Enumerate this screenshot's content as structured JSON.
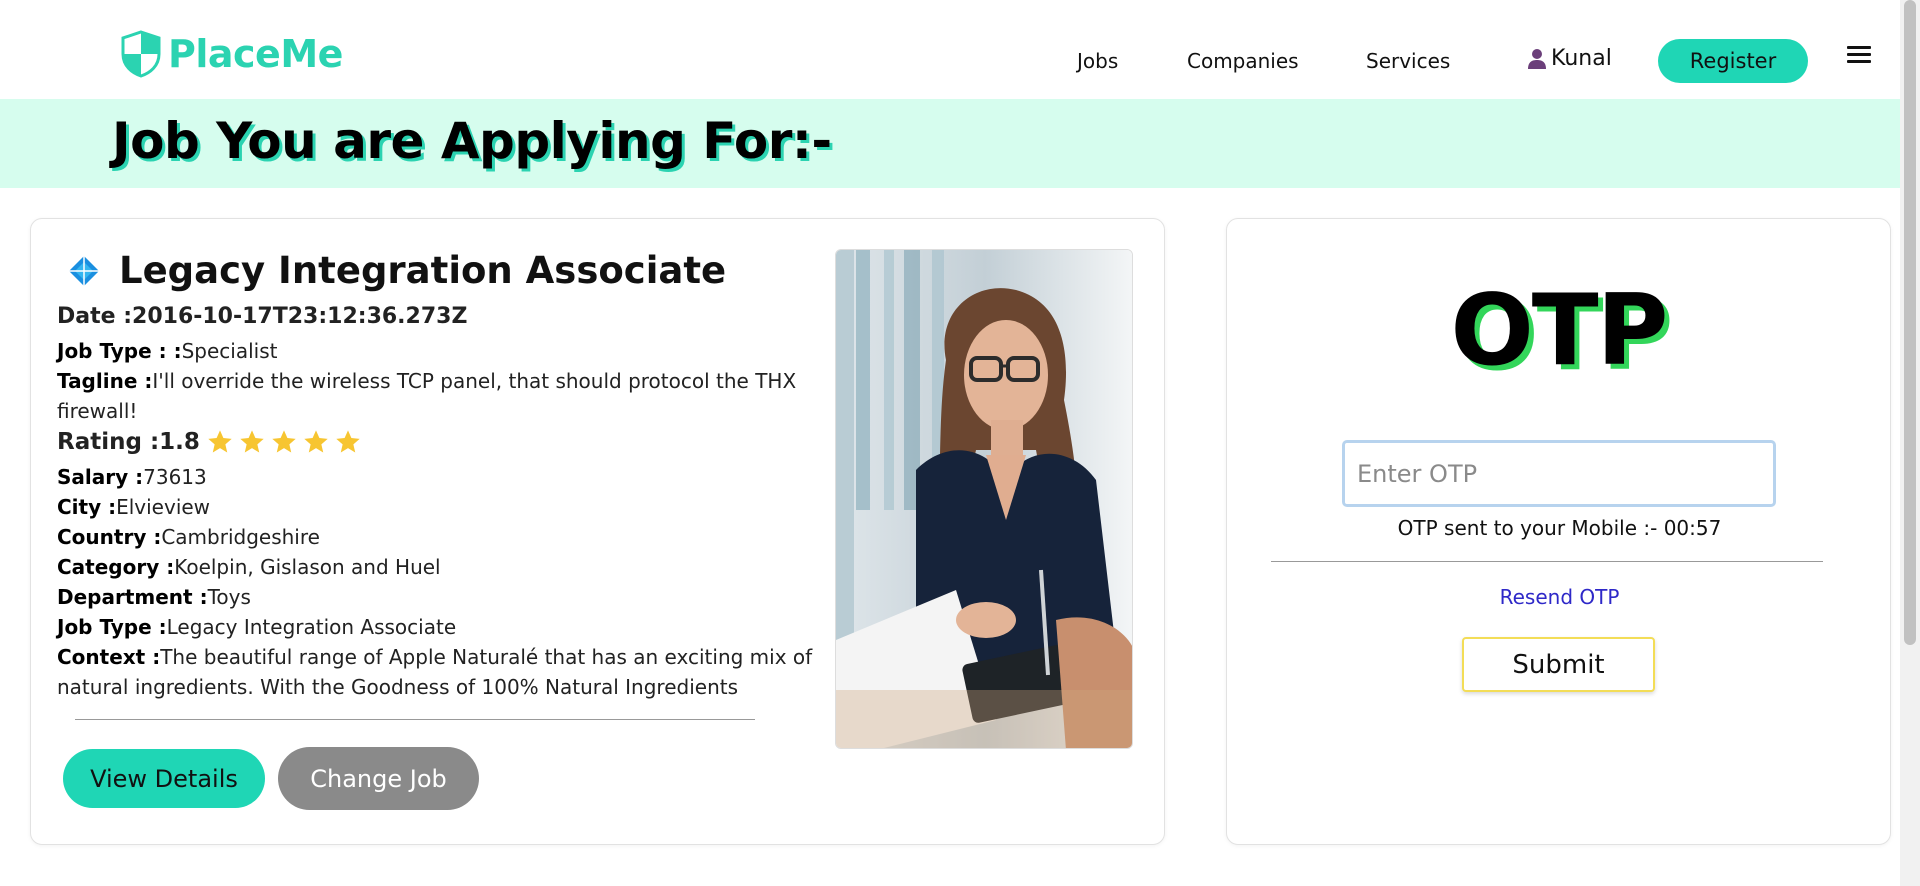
{
  "brand": {
    "name": "PlaceMe",
    "color": "#2bd3b1"
  },
  "nav": {
    "links": [
      "Jobs",
      "Companies",
      "Services"
    ],
    "user": "Kunal",
    "register": "Register"
  },
  "banner": {
    "title": "Job You are Applying For:-",
    "bg": "#d6fdee"
  },
  "job": {
    "title": "Legacy Integration Associate",
    "date_label": "Date :",
    "date_value": "2016-10-17T23:12:36.273Z",
    "fields": [
      {
        "label": "Job Type : :",
        "value": "Specialist"
      },
      {
        "label": "Tagline :",
        "value": "I'll override the wireless TCP panel, that should protocol the THX firewall!"
      }
    ],
    "rating_label": "Rating :",
    "rating_value": "1.8",
    "stars": 5,
    "details": [
      {
        "label": "Salary :",
        "value": "73613"
      },
      {
        "label": "City :",
        "value": "Elvieview"
      },
      {
        "label": "Country :",
        "value": "Cambridgeshire"
      },
      {
        "label": "Category :",
        "value": "Koelpin, Gislason and Huel"
      },
      {
        "label": "Department :",
        "value": "Toys"
      },
      {
        "label": "Job Type :",
        "value": "Legacy Integration Associate"
      },
      {
        "label": "Context :",
        "value": "The beautiful range of Apple Naturalé that has an exciting mix of natural ingredients. With the Goodness of 100% Natural Ingredients"
      }
    ],
    "view_details": "View Details",
    "change_job": "Change Job"
  },
  "otp": {
    "title": "OTP",
    "placeholder": "Enter OTP",
    "timer_text": "OTP sent to your Mobile :- 00:57",
    "resend": "Resend OTP",
    "submit": "Submit"
  },
  "colors": {
    "accent": "#1fd6b5",
    "otp_shadow": "#33d65a",
    "star": "#f7c531",
    "link": "#2e28c8"
  }
}
